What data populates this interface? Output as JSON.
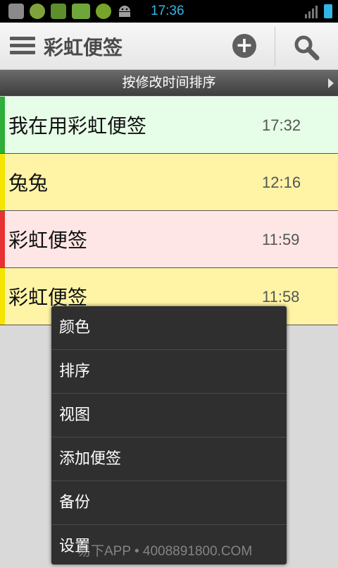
{
  "status_bar": {
    "time": "17:36",
    "icons": [
      "app-icon",
      "cloud-app-icon",
      "sync-icon",
      "battery-widget-icon",
      "gear-app-icon",
      "android-icon"
    ]
  },
  "action_bar": {
    "title": "彩虹便签",
    "icons": [
      "menu-icon",
      "add-icon",
      "search-icon"
    ]
  },
  "sort_bar": {
    "label": "按修改时间排序"
  },
  "notes": [
    {
      "title": "我在用彩虹便签",
      "time": "17:32",
      "color": "#2fae3a",
      "bg": "#e6fde7"
    },
    {
      "title": "兔兔",
      "time": "12:16",
      "color": "#f4e400",
      "bg": "#fff4a6"
    },
    {
      "title": "彩虹便签",
      "time": "11:59",
      "color": "#e63232",
      "bg": "#ffe6e6"
    },
    {
      "title": "彩虹便签",
      "time": "11:58",
      "color": "#f4e400",
      "bg": "#fff4a6"
    }
  ],
  "popup_menu": {
    "items": [
      "颜色",
      "排序",
      "视图",
      "添加便签",
      "备份",
      "设置"
    ]
  },
  "watermark": "易下APP • 4008891800.COM"
}
